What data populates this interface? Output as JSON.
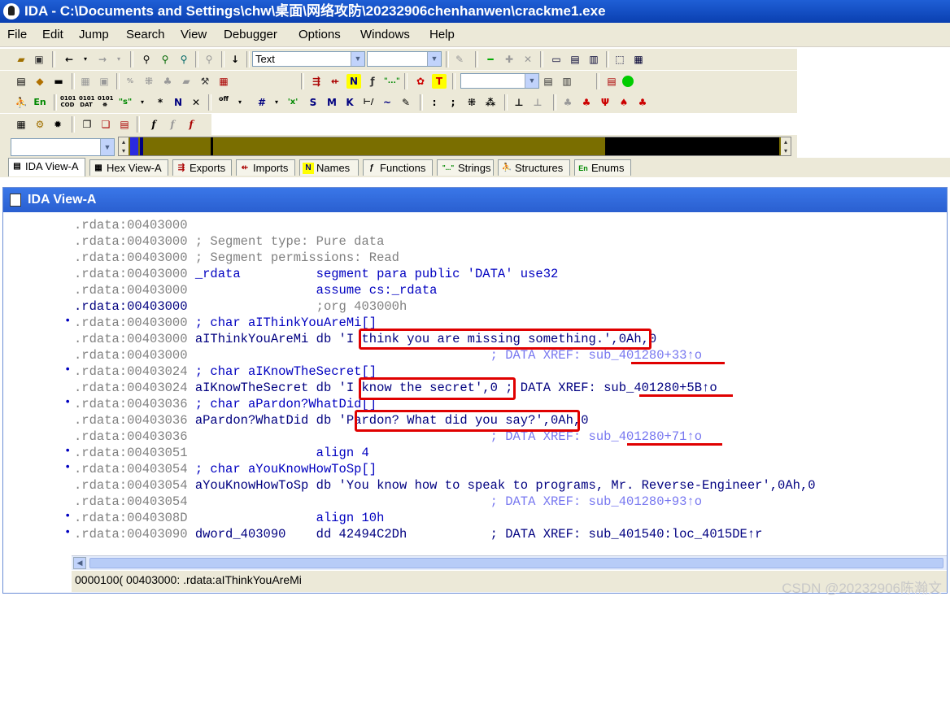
{
  "window": {
    "title": "IDA - C:\\Documents and Settings\\chw\\桌面\\网络攻防\\20232906chenhanwen\\crackme1.exe"
  },
  "menu": [
    "File",
    "Edit",
    "Jump",
    "Search",
    "View",
    "Debugger",
    "Options",
    "Windows",
    "Help"
  ],
  "toolbar": {
    "search_mode_value": "Text"
  },
  "tabs": [
    {
      "label": "IDA View-A",
      "icon": "document-icon"
    },
    {
      "label": "Hex View-A",
      "icon": "hex-icon"
    },
    {
      "label": "Exports",
      "icon": "exports-icon"
    },
    {
      "label": "Imports",
      "icon": "imports-icon"
    },
    {
      "label": "Names",
      "icon": "N"
    },
    {
      "label": "Functions",
      "icon": "functions-icon"
    },
    {
      "label": "Strings",
      "icon": "\"..\""
    },
    {
      "label": "Structures",
      "icon": "structures-icon"
    },
    {
      "label": "Enums",
      "icon": "En"
    }
  ],
  "view": {
    "title": "IDA View-A",
    "lines": [
      {
        "seg": ".rdata:00403000",
        "rest": ""
      },
      {
        "seg": ".rdata:00403000",
        "rest": " ; Segment type: Pure data"
      },
      {
        "seg": ".rdata:00403000",
        "rest": " ; Segment permissions: Read"
      },
      {
        "seg": ".rdata:00403000",
        "rest": " _rdata          segment para public 'DATA' use32"
      },
      {
        "seg": ".rdata:00403000",
        "rest": "                 assume cs:_rdata"
      },
      {
        "seg": ".rdata:00403000",
        "rest": "                 ;org 403000h"
      },
      {
        "seg": ".rdata:00403000",
        "rest": " ; char aIThinkYouAreMi[]"
      },
      {
        "seg": ".rdata:00403000",
        "rest": " aIThinkYouAreMi db 'I think you are missing something.',0Ah,0"
      },
      {
        "seg": ".rdata:00403000",
        "rest": "                                        ; DATA XREF: sub_401280+33↑o"
      },
      {
        "seg": ".rdata:00403024",
        "rest": " ; char aIKnowTheSecret[]"
      },
      {
        "seg": ".rdata:00403024",
        "rest": " aIKnowTheSecret db 'I know the secret',0 ; DATA XREF: sub_401280+5B↑o"
      },
      {
        "seg": ".rdata:00403036",
        "rest": " ; char aPardon?WhatDid[]"
      },
      {
        "seg": ".rdata:00403036",
        "rest": " aPardon?WhatDid db 'Pardon? What did you say?',0Ah,0"
      },
      {
        "seg": ".rdata:00403036",
        "rest": "                                        ; DATA XREF: sub_401280+71↑o"
      },
      {
        "seg": ".rdata:00403051",
        "rest": "                 align 4"
      },
      {
        "seg": ".rdata:00403054",
        "rest": " ; char aYouKnowHowToSp[]"
      },
      {
        "seg": ".rdata:00403054",
        "rest": " aYouKnowHowToSp db 'You know how to speak to programs, Mr. Reverse-Engineer',0Ah,0"
      },
      {
        "seg": ".rdata:00403054",
        "rest": "                                        ; DATA XREF: sub_401280+93↑o"
      },
      {
        "seg": ".rdata:0040308D",
        "rest": "                 align 10h"
      },
      {
        "seg": ".rdata:00403090",
        "rest": " dword_403090    dd 42494C2Dh           ; DATA XREF: sub_401540:loc_4015DE↑r"
      }
    ],
    "status": "0000100( 00403000: .rdata:aIThinkYouAreMi"
  },
  "watermark": "CSDN @20232906陈瀚文",
  "colors": {
    "annotation": "#e00000",
    "string": "#008000",
    "keyword": "#0000c0",
    "xref": "#7878f0"
  }
}
